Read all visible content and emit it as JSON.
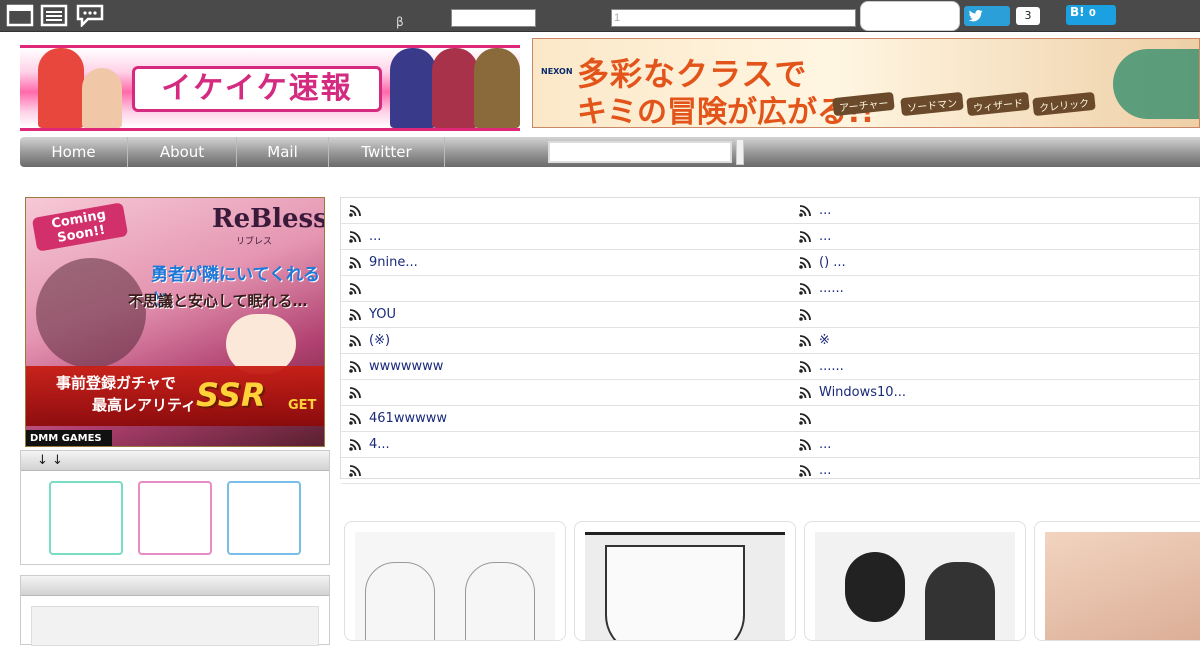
{
  "toolbar": {
    "beta_label": "β",
    "search_query_value": "1",
    "twitter_count": "3",
    "hatena_label": "B!",
    "hatena_count": "0"
  },
  "header": {
    "logo_text": "イケイケ速報",
    "ad_brand": "NEXON",
    "ad_line1": "多彩なクラスで",
    "ad_line2": "キミの冒険が広がる!!",
    "ad_classes": [
      "アーチャー",
      "ソードマン",
      "ウィザード",
      "クレリック"
    ]
  },
  "nav": {
    "items": [
      {
        "label": "Home"
      },
      {
        "label": "About"
      },
      {
        "label": "Mail"
      },
      {
        "label": "Twitter"
      }
    ]
  },
  "sidebar": {
    "ad": {
      "badge": "Coming Soon!!",
      "logo": "ReBless",
      "logo_sub": "リブレス",
      "copy1": "勇者が隣にいてくれると、",
      "copy2": "不思議と安心して眠れる…",
      "cta1": "事前登録ガチャで",
      "cta2": "最高レアリティ",
      "ssr": "SSR",
      "get": "GET",
      "footer": "DMM GAMES"
    },
    "share_widget_title": "↓ ↓",
    "second_widget_title": ""
  },
  "colors": {
    "share_box_1": "#7adcc4",
    "share_box_2": "#e88bc4",
    "share_box_3": "#7abde8",
    "rss_icon": "#222222",
    "link": "#1a2a7a"
  },
  "rss": {
    "rows": [
      {
        "left": "",
        "right": "..."
      },
      {
        "left": "...",
        "right": "..."
      },
      {
        "left": "9nine...",
        "right": "() ..."
      },
      {
        "left": "",
        "right": "......"
      },
      {
        "left": "YOU",
        "right": ""
      },
      {
        "left": "(※)",
        "right": "※"
      },
      {
        "left": "wwwwwww",
        "right": "......"
      },
      {
        "left": "",
        "right": "Windows10..."
      },
      {
        "left": "461wwwww",
        "right": ""
      },
      {
        "left": "4...",
        "right": "..."
      },
      {
        "left": "",
        "right": "..."
      }
    ]
  }
}
